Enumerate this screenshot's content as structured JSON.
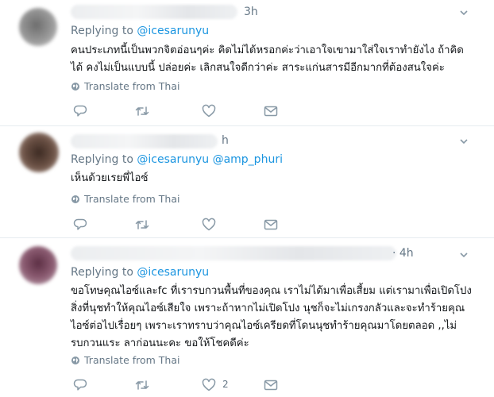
{
  "tweets": [
    {
      "time": "3h",
      "reply_prefix": "Replying to ",
      "mentions": [
        "@icesarunyu"
      ],
      "lines": [
        "คนประเภทนี้เป็นพวกจิตอ่อนๆค่ะ คิดไม่ได้หรอกค่ะว่าเอาใจเขามาใส่ใจเราทำยังไง ถ้าคิด",
        "ได้ คงไม่เป็นแบบนี้ ปล่อยค่ะ เลิกสนใจดีกว่าค่ะ สาระแก่นสารมีอีกมากที่ต้องสนใจค่ะ"
      ],
      "translate": "Translate from Thai",
      "like_count": ""
    },
    {
      "time": "h",
      "reply_prefix": "Replying to ",
      "mentions": [
        "@icesarunyu",
        "@amp_phuri"
      ],
      "lines": [
        "เห็นด้วยเรยพี่ไอซ์"
      ],
      "translate": "Translate from Thai",
      "like_count": ""
    },
    {
      "time": "· 4h",
      "reply_prefix": "Replying to ",
      "mentions": [
        "@icesarunyu"
      ],
      "lines": [
        "ขอโทษคุณไอซ์และfc ที่เรารบกวนพื้นที่ของคุณ เราไม่ได้มาเพื่อเสี้ยม แต่เรามาเพื่อเปิดโปง",
        "สิ่งที่นุชทำให้คุณไอซ์เสียใจ เพราะถ้าหากไม่เปิดโปง นุชก็จะไม่เกรงกลัวและจะทำร้ายคุณ",
        "ไอซ์ต่อไปเรื่อยๆ เพราะเราทราบว่าคุณไอซ์เครียดที่โดนนุชทำร้ายคุณมาโดยตลอด ,,ไม่",
        "รบกวนแระ ลาก่อนนะคะ ขอให้โชคดีค่ะ"
      ],
      "translate": "Translate from Thai",
      "like_count": "2"
    }
  ],
  "icons": [
    "globe-icon",
    "reply-icon",
    "retweet-icon",
    "like-icon",
    "message-icon",
    "chevron-down-icon"
  ],
  "colors": {
    "link": "#1b95e0",
    "muted": "#657786",
    "text": "#14171a",
    "divider": "#e6ecf0"
  }
}
